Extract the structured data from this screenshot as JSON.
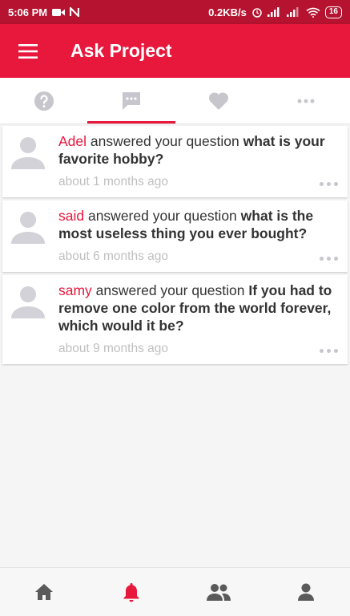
{
  "status_bar": {
    "time": "5:06 PM",
    "speed": "0.2KB/s",
    "battery": "16"
  },
  "app_bar": {
    "title": "Ask Project"
  },
  "tabs": [
    {
      "icon": "question-icon",
      "active": false
    },
    {
      "icon": "chat-icon",
      "active": true
    },
    {
      "icon": "heart-icon",
      "active": false
    },
    {
      "icon": "more-icon",
      "active": false
    }
  ],
  "notifications": [
    {
      "user": "Adel",
      "text": " answered your question ",
      "question": "what is your favorite hobby?",
      "time": "about 1 months ago"
    },
    {
      "user": "said",
      "text": " answered your question ",
      "question": "what is the most useless thing you ever bought?",
      "time": "about 6 months ago"
    },
    {
      "user": "samy",
      "text": " answered your question ",
      "question": "If you had to remove one color from the world forever, which would it be?",
      "time": "about 9 months ago"
    }
  ],
  "bottom_nav": [
    {
      "icon": "home-icon",
      "active": false
    },
    {
      "icon": "bell-icon",
      "active": true
    },
    {
      "icon": "group-icon",
      "active": false
    },
    {
      "icon": "profile-icon",
      "active": false
    }
  ],
  "colors": {
    "accent": "#e8173c",
    "status_bar": "#b5132f",
    "muted": "#c0c0c0"
  }
}
